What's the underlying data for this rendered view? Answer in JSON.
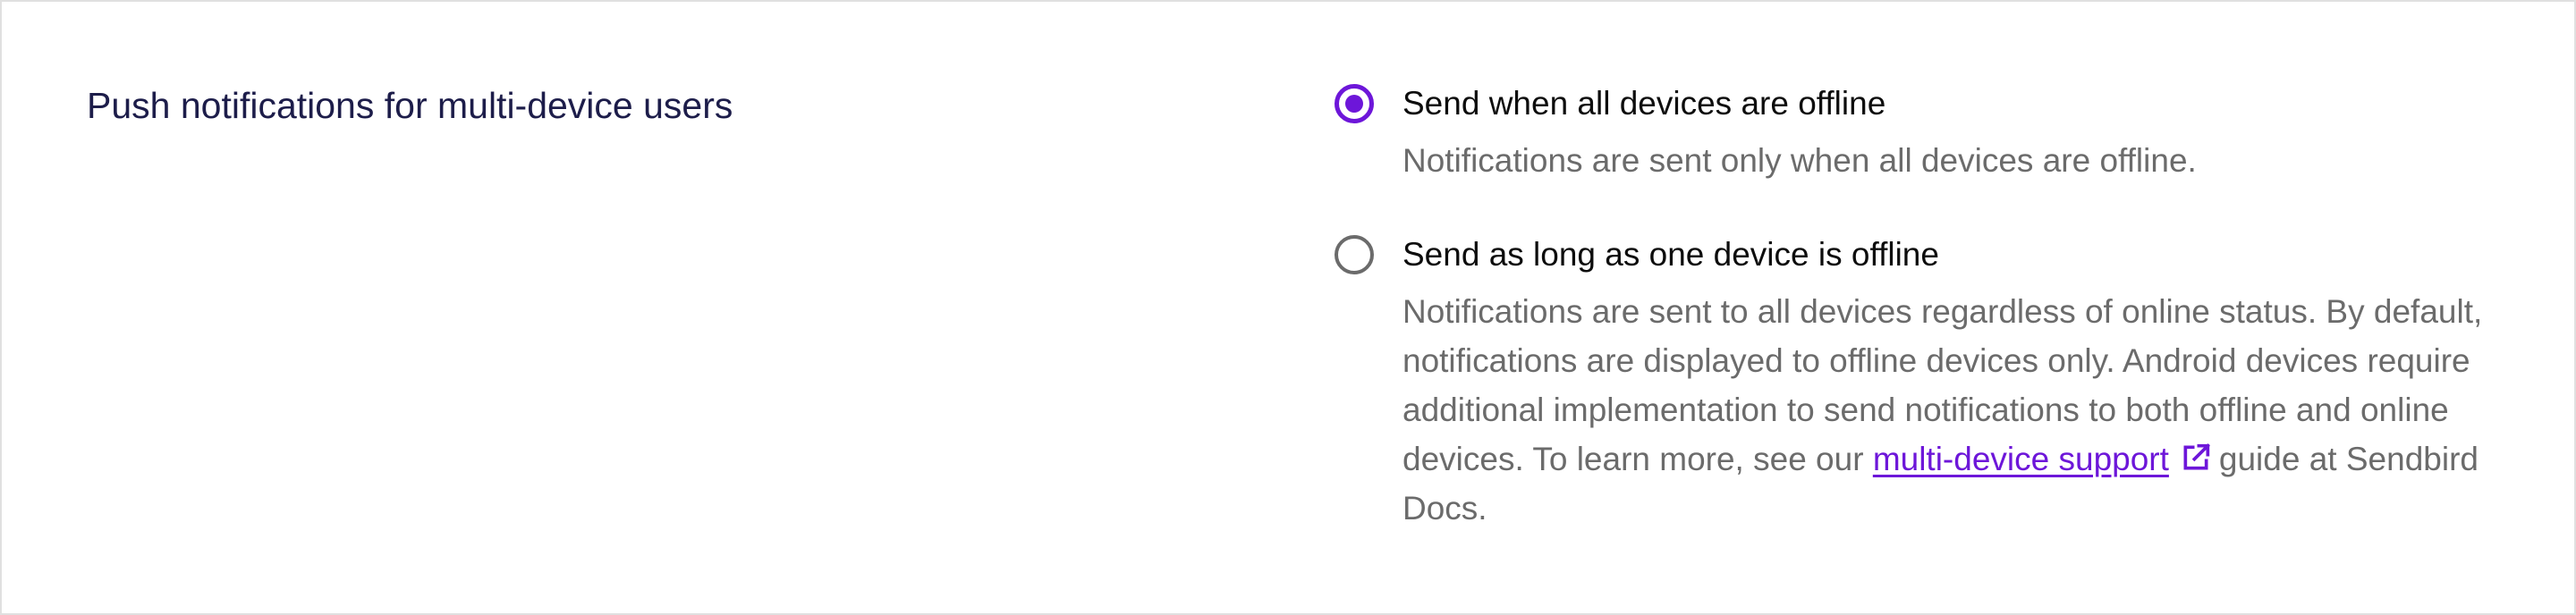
{
  "section": {
    "title": "Push notifications for multi-device users"
  },
  "options": [
    {
      "label": "Send when all devices are offline",
      "selected": true,
      "description": "Notifications are sent only when all devices are offline."
    },
    {
      "label": "Send as long as one device is offline",
      "selected": false,
      "description_before_link": "Notifications are sent to all devices regardless of online status. By default, notifications are displayed to offline devices only. Android devices require additional implementation to send notifications to both offline and online devices. To learn more, see our ",
      "link_text": "multi-device support",
      "link_icon": "external-link-icon",
      "description_after_link": "guide at Sendbird Docs."
    }
  ],
  "colors": {
    "accent": "#6d16d9",
    "title_text": "#1d1d4a",
    "body_text": "#0d0d0d",
    "muted_text": "#6b6b6b",
    "border": "#e0e0e0"
  }
}
